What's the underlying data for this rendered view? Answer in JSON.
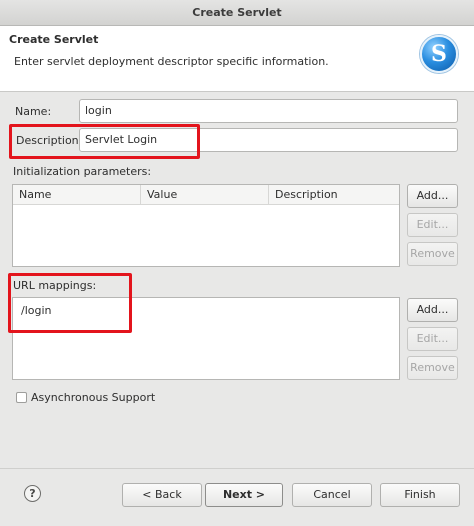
{
  "window": {
    "title": "Create Servlet"
  },
  "banner": {
    "title": "Create Servlet",
    "description": "Enter servlet deployment descriptor specific information.",
    "logo_icon": "servlet-s-logo-icon",
    "logo_glyph": "S"
  },
  "form": {
    "name_label": "Name:",
    "name_value": "login",
    "description_label": "Description:",
    "description_value": "Servlet Login"
  },
  "init_params": {
    "label": "Initialization parameters:",
    "columns": [
      "Name",
      "Value",
      "Description"
    ],
    "rows": [],
    "buttons": {
      "add": "Add...",
      "edit": "Edit...",
      "remove": "Remove"
    }
  },
  "url_mappings": {
    "label": "URL mappings:",
    "items": [
      "/login"
    ],
    "buttons": {
      "add": "Add...",
      "edit": "Edit...",
      "remove": "Remove"
    }
  },
  "async": {
    "label": "Asynchronous Support",
    "checked": false
  },
  "footer": {
    "help_glyph": "?",
    "back": "< Back",
    "next": "Next >",
    "cancel": "Cancel",
    "finish": "Finish"
  },
  "colors": {
    "highlight": "#e3141c",
    "background": "#e8e8e7",
    "field_border": "#b6b6b4"
  }
}
